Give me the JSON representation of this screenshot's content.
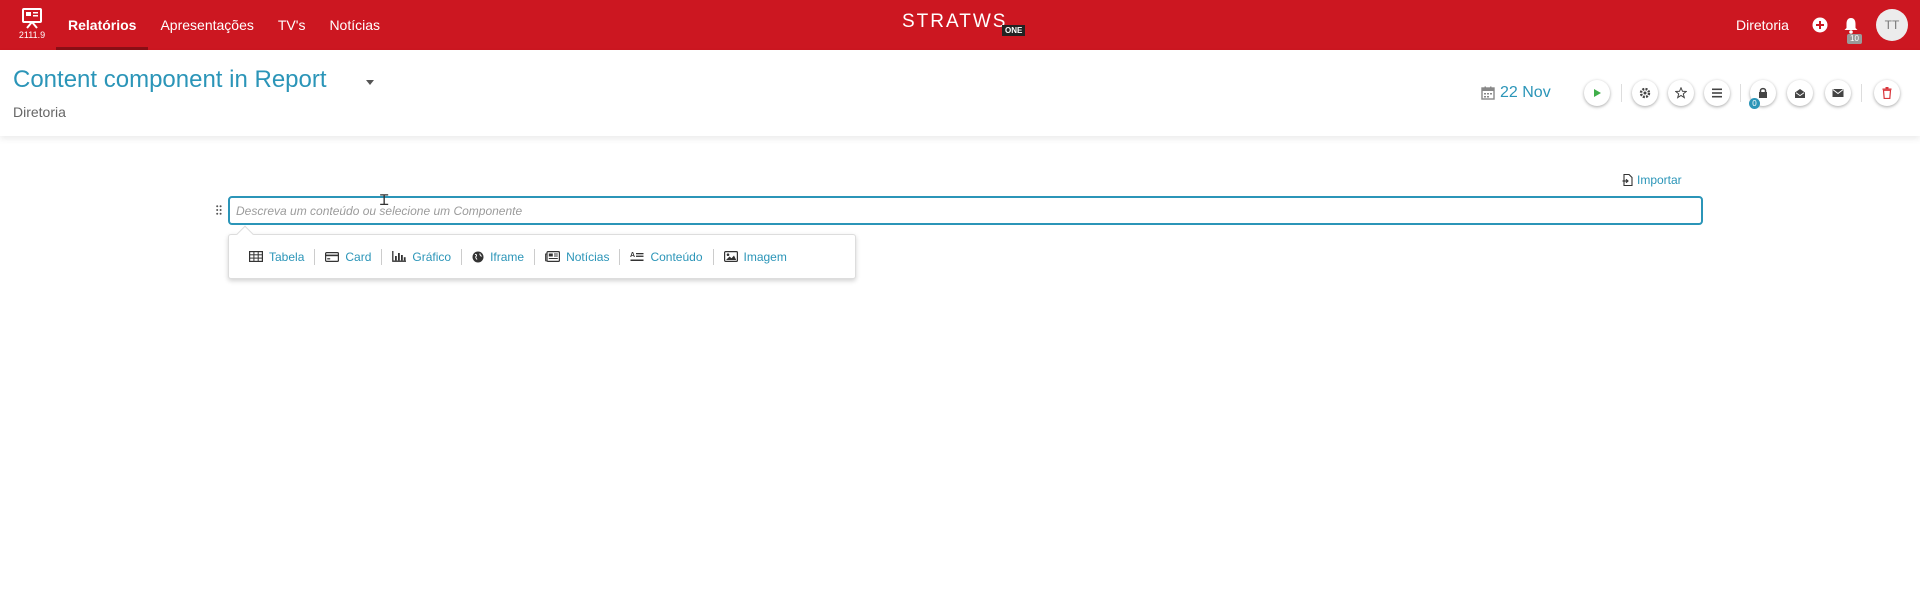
{
  "app": {
    "version": "2111.9",
    "logo_text": "STRATWS",
    "logo_badge": "ONE"
  },
  "nav": {
    "items": [
      {
        "label": "Relatórios",
        "active": true
      },
      {
        "label": "Apresentações",
        "active": false
      },
      {
        "label": "TV's",
        "active": false
      },
      {
        "label": "Notícias",
        "active": false
      }
    ]
  },
  "topbar": {
    "org": "Diretoria",
    "bell_count": "10",
    "avatar": "TT"
  },
  "page": {
    "title": "Content component in Report",
    "subtitle": "Diretoria",
    "date": "22 Nov",
    "lock_count": "0"
  },
  "editor": {
    "import_label": "Importar",
    "placeholder": "Descreva um conteúdo ou selecione um Componente"
  },
  "components": [
    {
      "label": "Tabela",
      "icon": "table-icon"
    },
    {
      "label": "Card",
      "icon": "card-icon"
    },
    {
      "label": "Gráfico",
      "icon": "bar-chart-icon"
    },
    {
      "label": "Iframe",
      "icon": "globe-icon"
    },
    {
      "label": "Notícias",
      "icon": "newspaper-icon"
    },
    {
      "label": "Conteúdo",
      "icon": "text-content-icon"
    },
    {
      "label": "Imagem",
      "icon": "image-icon"
    }
  ],
  "colors": {
    "brand_red": "#cc1721",
    "accent_blue": "#2b95b8",
    "play_green": "#3fae49",
    "delete_red": "#d9343a"
  }
}
